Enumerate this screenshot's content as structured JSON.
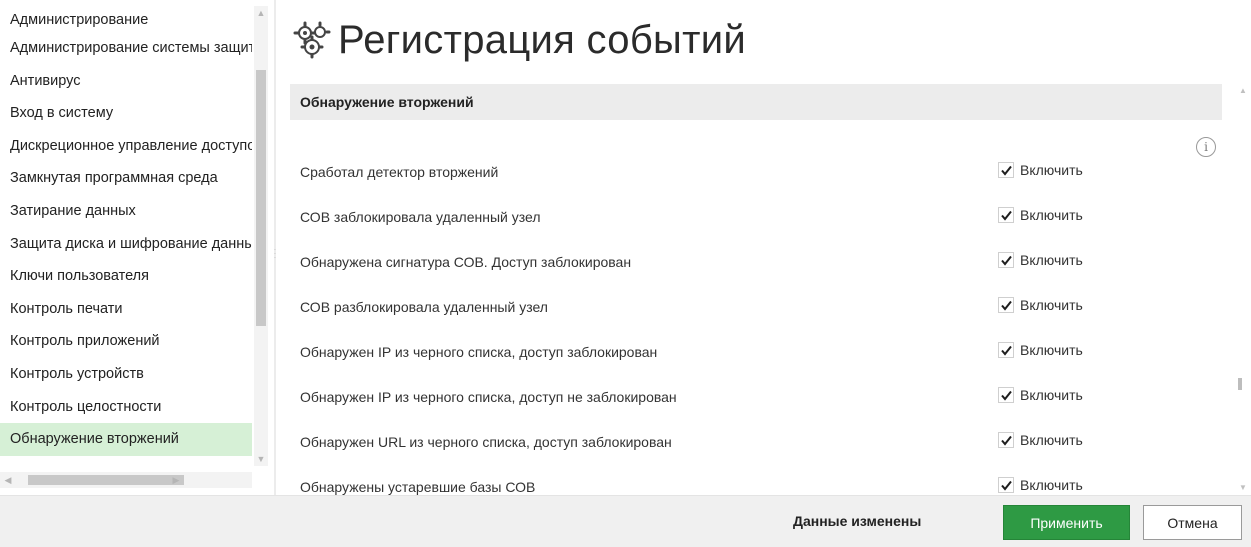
{
  "sidebar": {
    "items": [
      {
        "label": "Администрирование"
      },
      {
        "label": "Администрирование системы защиты"
      },
      {
        "label": "Антивирус"
      },
      {
        "label": "Вход в систему"
      },
      {
        "label": "Дискреционное управление доступом"
      },
      {
        "label": "Замкнутая программная среда"
      },
      {
        "label": "Затирание данных"
      },
      {
        "label": "Защита диска и шифрование данных"
      },
      {
        "label": "Ключи пользователя"
      },
      {
        "label": "Контроль печати"
      },
      {
        "label": "Контроль приложений"
      },
      {
        "label": "Контроль устройств"
      },
      {
        "label": "Контроль целостности"
      },
      {
        "label": "Обнаружение вторжений",
        "selected": true
      }
    ]
  },
  "main": {
    "title": "Регистрация событий",
    "title_icon": "gear-cluster-icon",
    "section_title": "Обнаружение вторжений",
    "info_icon": "info-icon",
    "info_glyph": "i",
    "rows": [
      {
        "label": "Сработал детектор вторжений",
        "enable_label": "Включить",
        "checked": true
      },
      {
        "label": "СОВ заблокировала удаленный узел",
        "enable_label": "Включить",
        "checked": true
      },
      {
        "label": "Обнаружена сигнатура СОВ. Доступ заблокирован",
        "enable_label": "Включить",
        "checked": true
      },
      {
        "label": "СОВ разблокировала удаленный узел",
        "enable_label": "Включить",
        "checked": true
      },
      {
        "label": "Обнаружен IP из черного списка, доступ заблокирован",
        "enable_label": "Включить",
        "checked": true
      },
      {
        "label": "Обнаружен IP из черного списка, доступ не заблокирован",
        "enable_label": "Включить",
        "checked": true
      },
      {
        "label": "Обнаружен URL из черного списка, доступ заблокирован",
        "enable_label": "Включить",
        "checked": true
      },
      {
        "label": "Обнаружены устаревшие базы СОВ",
        "enable_label": "Включить",
        "checked": true
      }
    ]
  },
  "footer": {
    "status": "Данные изменены",
    "apply_label": "Применить",
    "cancel_label": "Отмена"
  },
  "colors": {
    "accent_green": "#2e9a44",
    "selected_bg": "#d6f0d6",
    "section_bg": "#ececec"
  }
}
